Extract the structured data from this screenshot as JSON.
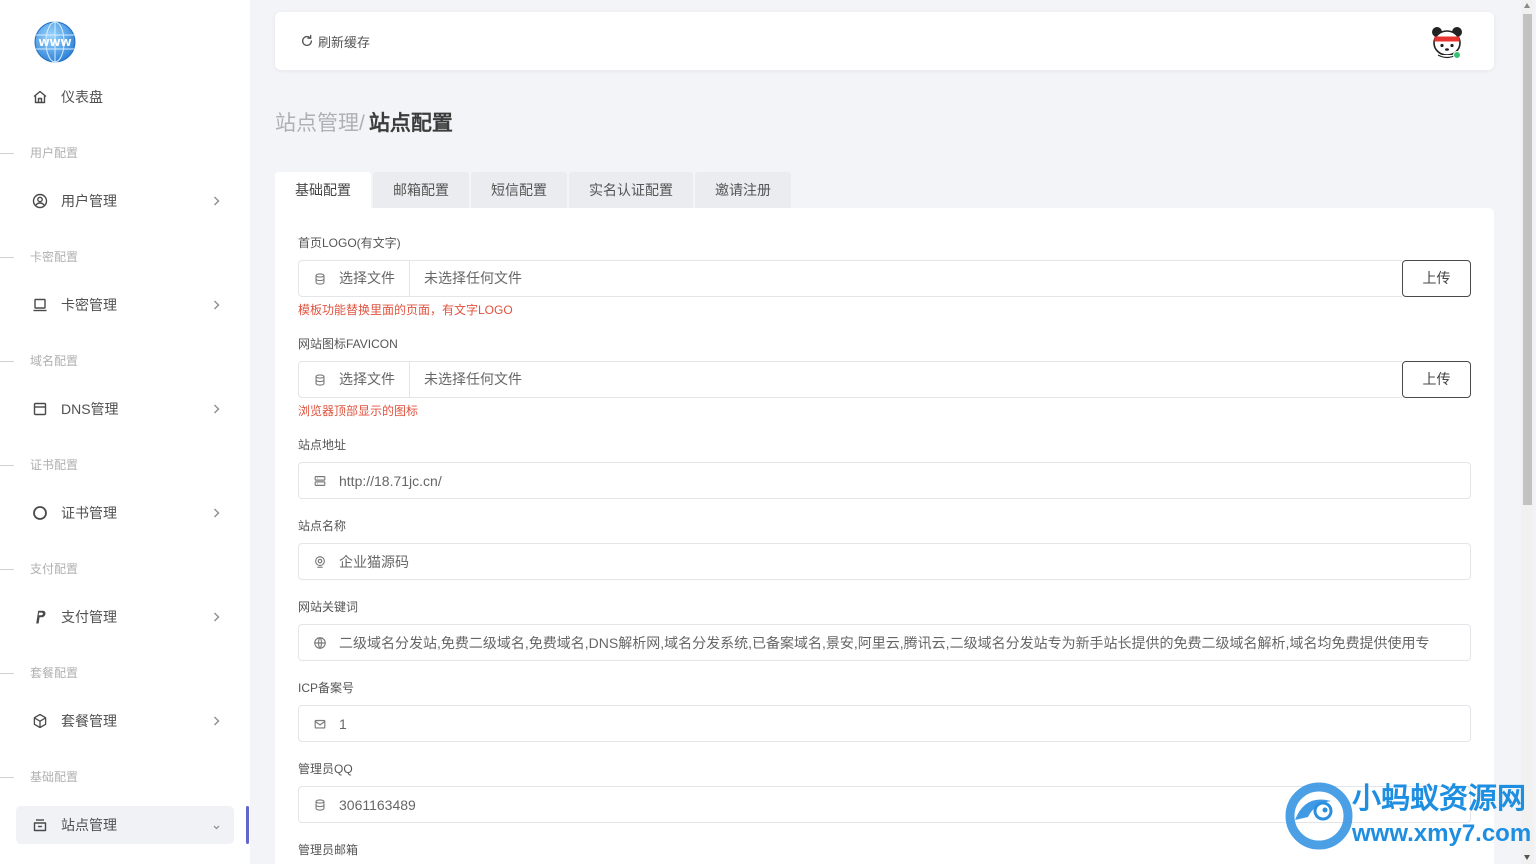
{
  "app": {
    "logo_icon": "globe-www-logo",
    "logo_text": "WWW"
  },
  "sidebar": {
    "dashboard": {
      "label": "仪表盘",
      "icon": "home-icon"
    },
    "sections": [
      {
        "title": "用户配置",
        "item": {
          "label": "用户管理",
          "icon": "user-circle-icon"
        }
      },
      {
        "title": "卡密配置",
        "item": {
          "label": "卡密管理",
          "icon": "laptop-icon"
        }
      },
      {
        "title": "域名配置",
        "item": {
          "label": "DNS管理",
          "icon": "window-icon"
        }
      },
      {
        "title": "证书配置",
        "item": {
          "label": "证书管理",
          "icon": "circle-icon"
        }
      },
      {
        "title": "支付配置",
        "item": {
          "label": "支付管理",
          "icon": "paypal-icon"
        }
      },
      {
        "title": "套餐配置",
        "item": {
          "label": "套餐管理",
          "icon": "package-icon"
        }
      },
      {
        "title": "基础配置",
        "item": {
          "label": "站点管理",
          "icon": "archive-icon",
          "active": true
        }
      }
    ]
  },
  "topbar": {
    "refresh_label": "刷新缓存",
    "refresh_icon": "refresh-icon",
    "avatar_icon": "bear-avatar-icon"
  },
  "breadcrumb": {
    "parent": "站点管理/",
    "current": "站点配置"
  },
  "tabs": {
    "items": [
      "基础配置",
      "邮箱配置",
      "短信配置",
      "实名认证配置",
      "邀请注册"
    ],
    "active_index": 0
  },
  "form": {
    "logo": {
      "label": "首页LOGO(有文字)",
      "choose_label": "选择文件",
      "file_name": "未选择任何文件",
      "upload_label": "上传",
      "help": "模板功能替换里面的页面，有文字LOGO",
      "icon": "database-icon"
    },
    "favicon": {
      "label": "网站图标FAVICON",
      "choose_label": "选择文件",
      "file_name": "未选择任何文件",
      "upload_label": "上传",
      "help": "浏览器顶部显示的图标",
      "icon": "database-icon"
    },
    "site_url": {
      "label": "站点地址",
      "value": "http://18.71jc.cn/",
      "icon": "server-icon"
    },
    "site_name": {
      "label": "站点名称",
      "value": "企业猫源码",
      "icon": "webcam-icon"
    },
    "keywords": {
      "label": "网站关键词",
      "value": "二级域名分发站,免费二级域名,免费域名,DNS解析网,域名分发系统,已备案域名,景安,阿里云,腾讯云,二级域名分发站专为新手站长提供的免费二级域名解析,域名均免费提供使用专",
      "icon": "globe-icon"
    },
    "icp": {
      "label": "ICP备案号",
      "value": "1",
      "icon": "mail-icon"
    },
    "admin_qq": {
      "label": "管理员QQ",
      "value": "3061163489",
      "icon": "database-icon"
    },
    "admin_email": {
      "label": "管理员邮箱"
    }
  },
  "watermark": {
    "name": "小蚂蚁资源网",
    "url": "www.xmy7.com"
  },
  "colors": {
    "accent": "#6366c9",
    "help_text": "#e0533f",
    "online_dot": "#38c172",
    "watermark": "#1e8ee0"
  }
}
